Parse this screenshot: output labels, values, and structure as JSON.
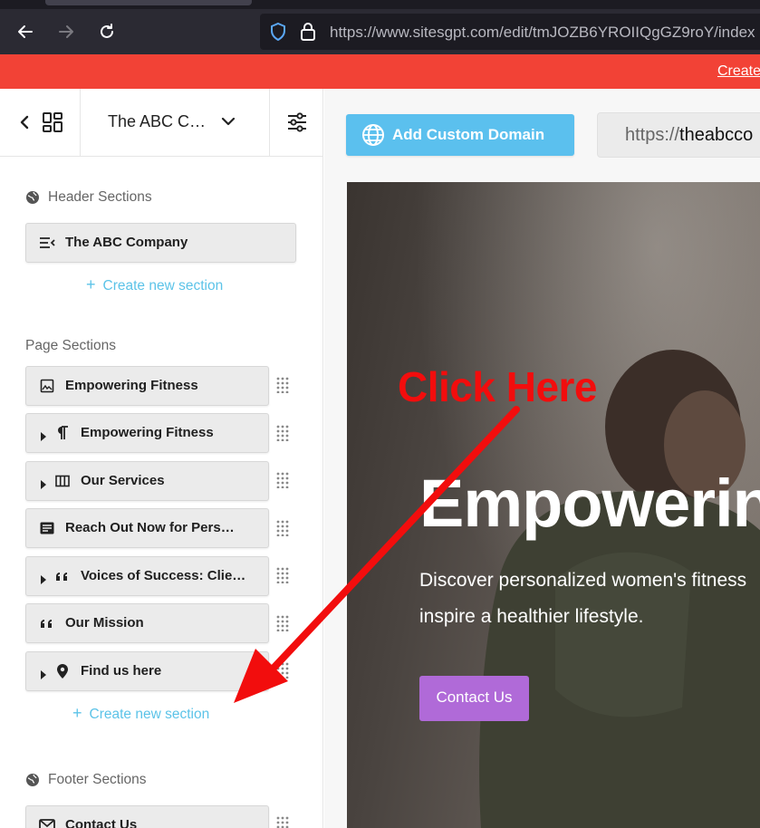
{
  "browser": {
    "url": "https://www.sitesgpt.com/edit/tmJOZB6YROIIQgGZ9roY/index"
  },
  "banner": {
    "link_text": "Create"
  },
  "sidebar": {
    "site_title": "The ABC C…",
    "header_group": {
      "label": "Header Sections",
      "items": [
        {
          "label": "The ABC Company",
          "icon": "menu-icon"
        }
      ],
      "create_label": "Create new section"
    },
    "page_group": {
      "label": "Page Sections",
      "items": [
        {
          "label": "Empowering Fitness",
          "icon": "image-icon",
          "expandable": false
        },
        {
          "label": "Empowering Fitness",
          "icon": "paragraph-icon",
          "expandable": true
        },
        {
          "label": "Our Services",
          "icon": "columns-icon",
          "expandable": true
        },
        {
          "label": "Reach Out Now for Pers…",
          "icon": "form-icon",
          "expandable": false
        },
        {
          "label": "Voices of Success: Clie…",
          "icon": "quote-icon",
          "expandable": true
        },
        {
          "label": "Our Mission",
          "icon": "quote-icon",
          "expandable": false
        },
        {
          "label": "Find us here",
          "icon": "map-pin-icon",
          "expandable": true
        }
      ],
      "create_label": "Create new section"
    },
    "footer_group": {
      "label": "Footer Sections",
      "items": [
        {
          "label": "Contact Us",
          "icon": "mail-icon"
        }
      ]
    }
  },
  "main": {
    "domain_button": "Add Custom Domain",
    "site_url_prefix": "https://",
    "site_url_rest": "theabcco",
    "hero": {
      "title": "Empowerin",
      "subtitle_line1": "Discover personalized women's fitness",
      "subtitle_line2": "inspire a healthier lifestyle.",
      "cta": "Contact Us"
    }
  },
  "annotation": {
    "text": "Click Here",
    "color": "#f20d0d"
  },
  "colors": {
    "banner": "#f24236",
    "accent": "#5bc0ee",
    "cta": "#b06ad8",
    "create_link": "#5cc3e8"
  }
}
